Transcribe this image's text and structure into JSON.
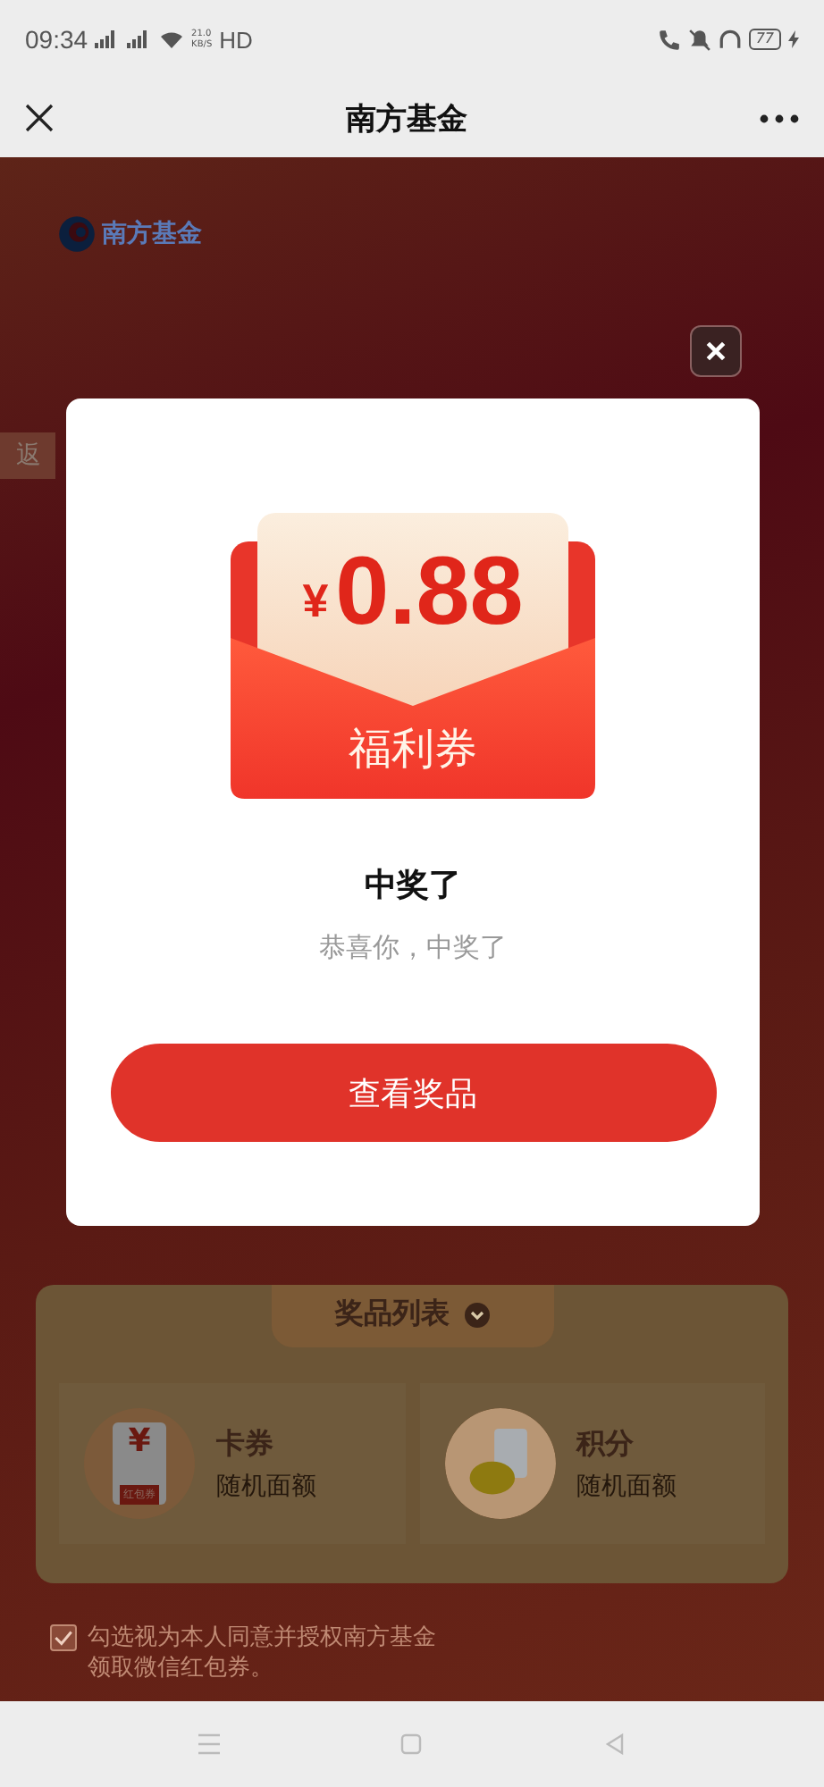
{
  "status_bar": {
    "time": "09:34",
    "speed_value": "21.0",
    "speed_unit": "KB/S",
    "network": "HD",
    "battery": "77"
  },
  "nav_bar": {
    "title": "南方基金"
  },
  "page": {
    "logo_text": "南方基金",
    "back_tab": "返",
    "prize_list": {
      "title": "奖品列表",
      "items": [
        {
          "kind": "coupon",
          "name": "卡券",
          "desc": "随机面额",
          "symbol": "¥",
          "badge": "红包券"
        },
        {
          "kind": "points",
          "name": "积分",
          "desc": "随机面额"
        }
      ]
    },
    "consent": {
      "checked": true,
      "line_1": "勾选视为本人同意并授权南方基金",
      "line_2": "领取微信红包券。"
    }
  },
  "dialog": {
    "currency": "¥",
    "amount": "0.88",
    "voucher_label": "福利券",
    "title": "中奖了",
    "subtitle": "恭喜你，中奖了",
    "button": "查看奖品"
  }
}
